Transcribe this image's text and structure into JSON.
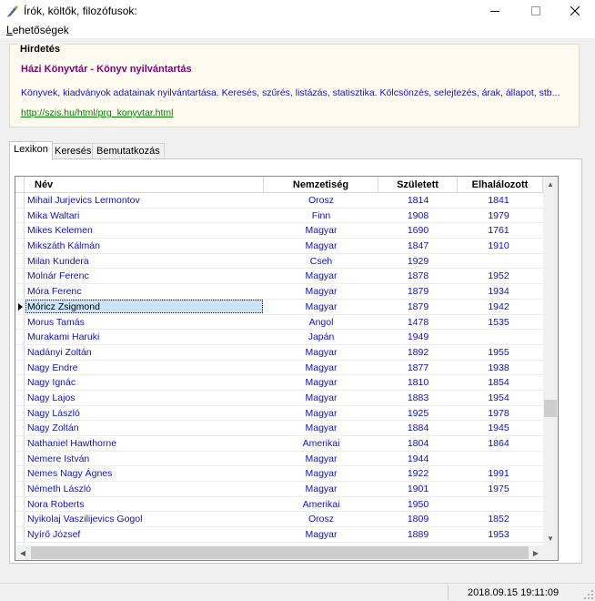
{
  "window": {
    "title": "Írók, költők, filozófusok:",
    "menu_label": "Lehetőségek",
    "menu_accel": "L",
    "menu_rest": "ehetőségek"
  },
  "ad": {
    "legend": "Hirdetés",
    "title": "Házi Könyvtár - Könyv nyilvántartás",
    "description": "Könyvek, kiadványok adatainak nyilvántartása. Keresés, szűrés, listázás, statisztika. Kölcsönzés, selejtezés, árak, állapot, stb...",
    "link": "http://szis.hu/html/prg_konyvtar.html"
  },
  "tabs": [
    {
      "label": "Lexikon",
      "active": true
    },
    {
      "label": "Keresés",
      "active": false
    },
    {
      "label": "Bemutatkozás",
      "active": false
    }
  ],
  "grid": {
    "columns": [
      "Név",
      "Nemzetiség",
      "Született",
      "Elhalálozott"
    ],
    "selected_row": 7,
    "rows": [
      {
        "name": "Mihail Jurjevics Lermontov",
        "nationality": "Orosz",
        "born": "1814",
        "died": "1841"
      },
      {
        "name": "Mika Waltari",
        "nationality": "Finn",
        "born": "1908",
        "died": "1979"
      },
      {
        "name": "Mikes Kelemen",
        "nationality": "Magyar",
        "born": "1690",
        "died": "1761"
      },
      {
        "name": "Mikszáth Kálmán",
        "nationality": "Magyar",
        "born": "1847",
        "died": "1910"
      },
      {
        "name": "Milan Kundera",
        "nationality": "Cseh",
        "born": "1929",
        "died": ""
      },
      {
        "name": "Molnár Ferenc",
        "nationality": "Magyar",
        "born": "1878",
        "died": "1952"
      },
      {
        "name": "Móra Ferenc",
        "nationality": "Magyar",
        "born": "1879",
        "died": "1934"
      },
      {
        "name": "Móricz Zsigmond",
        "nationality": "Magyar",
        "born": "1879",
        "died": "1942"
      },
      {
        "name": "Morus Tamás",
        "nationality": "Angol",
        "born": "1478",
        "died": "1535"
      },
      {
        "name": "Murakami Haruki",
        "nationality": "Japán",
        "born": "1949",
        "died": ""
      },
      {
        "name": "Nadányi Zoltán",
        "nationality": "Magyar",
        "born": "1892",
        "died": "1955"
      },
      {
        "name": "Nagy Endre",
        "nationality": "Magyar",
        "born": "1877",
        "died": "1938"
      },
      {
        "name": "Nagy Ignác",
        "nationality": "Magyar",
        "born": "1810",
        "died": "1854"
      },
      {
        "name": "Nagy Lajos",
        "nationality": "Magyar",
        "born": "1883",
        "died": "1954"
      },
      {
        "name": "Nagy László",
        "nationality": "Magyar",
        "born": "1925",
        "died": "1978"
      },
      {
        "name": "Nagy Zoltán",
        "nationality": "Magyar",
        "born": "1884",
        "died": "1945"
      },
      {
        "name": "Nathaniel Hawthorne",
        "nationality": "Amerikai",
        "born": "1804",
        "died": "1864"
      },
      {
        "name": "Nemere István",
        "nationality": "Magyar",
        "born": "1944",
        "died": ""
      },
      {
        "name": "Nemes Nagy Ágnes",
        "nationality": "Magyar",
        "born": "1922",
        "died": "1991"
      },
      {
        "name": "Németh László",
        "nationality": "Magyar",
        "born": "1901",
        "died": "1975"
      },
      {
        "name": "Nora Roberts",
        "nationality": "Amerikai",
        "born": "1950",
        "died": ""
      },
      {
        "name": "Nyikolaj Vaszilijevics Gogol",
        "nationality": "Orosz",
        "born": "1809",
        "died": "1852"
      },
      {
        "name": "Nyírő József",
        "nationality": "Magyar",
        "born": "1889",
        "died": "1953"
      }
    ]
  },
  "status": {
    "datetime": "2018.09.15 19:11:09"
  },
  "colors": {
    "cell_text": "#1010c8",
    "ad_title": "#800080",
    "ad_link": "#008000",
    "selection": "#cde3f7"
  },
  "icons": {
    "app": "pen-icon",
    "minimize": "minimize-icon",
    "maximize": "maximize-icon",
    "close": "close-icon"
  }
}
